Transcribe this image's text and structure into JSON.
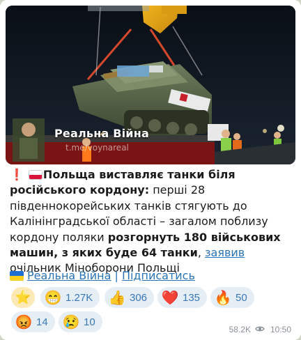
{
  "post": {
    "image": {
      "watermark_title": "Реальна Війна",
      "watermark_url": "t.me/voynareal"
    },
    "message": {
      "lead_emoji": "❗",
      "headline": "Польща виставляє танки біля російського кордону:",
      "body_1": " перші 28 південнокорейських танків стягують до Калінінградської області – загалом поблизу кордону поляки ",
      "bold_2": "розгорнуть 180 військових машин, з яких буде 64 танки",
      "body_3": ", ",
      "link_text": "заявив",
      "body_4": " очільник Міноборони Польщі"
    },
    "footer": {
      "channel_link": "Реальна Війна",
      "separator": " | ",
      "subscribe_link": "Підписатись"
    },
    "reactions": [
      {
        "emoji": "😁",
        "icon": "grinning-face-icon",
        "count": "1.27K"
      },
      {
        "emoji": "👍",
        "icon": "thumbs-up-icon",
        "count": "306"
      },
      {
        "emoji": "❤️",
        "icon": "red-heart-icon",
        "count": "135"
      },
      {
        "emoji": "🔥",
        "icon": "fire-icon",
        "count": "50"
      },
      {
        "emoji": "😡",
        "icon": "angry-face-icon",
        "count": "14"
      },
      {
        "emoji": "😢",
        "icon": "crying-face-icon",
        "count": "10"
      }
    ],
    "star_reaction": {
      "emoji": "⭐",
      "icon": "star-icon"
    },
    "views": "58.2K",
    "time": "10:50",
    "colors": {
      "link": "#2a74b5",
      "reaction_bg": "#e6eef5",
      "reaction_count": "#3a78b5",
      "star_bg": "#fbe9b7",
      "meta": "#8a9099"
    }
  }
}
